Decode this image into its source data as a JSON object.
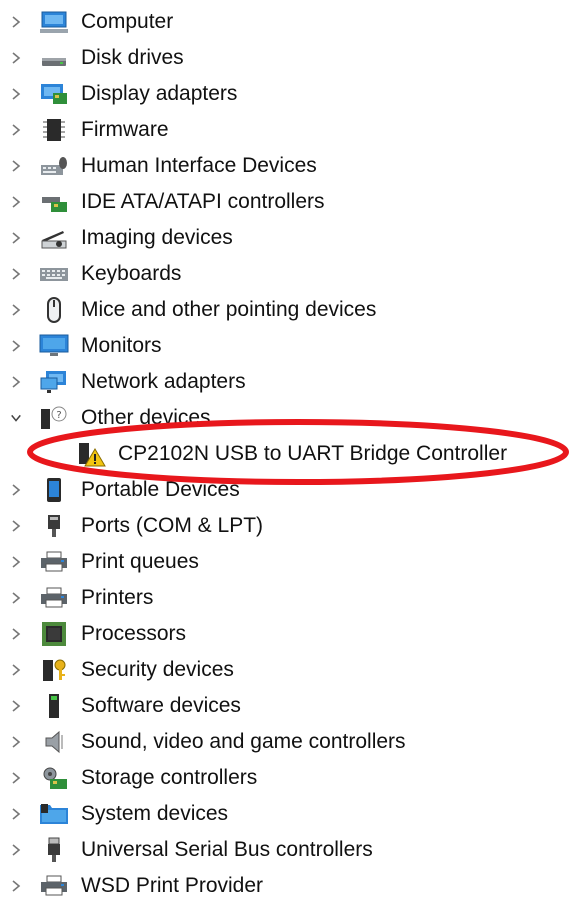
{
  "tree": {
    "items": [
      {
        "label": "Computer",
        "icon": "computer-icon"
      },
      {
        "label": "Disk drives",
        "icon": "disk-drive-icon"
      },
      {
        "label": "Display adapters",
        "icon": "display-adapter-icon"
      },
      {
        "label": "Firmware",
        "icon": "firmware-icon"
      },
      {
        "label": "Human Interface Devices",
        "icon": "hid-icon"
      },
      {
        "label": "IDE ATA/ATAPI controllers",
        "icon": "ide-controller-icon"
      },
      {
        "label": "Imaging devices",
        "icon": "imaging-device-icon"
      },
      {
        "label": "Keyboards",
        "icon": "keyboard-icon"
      },
      {
        "label": "Mice and other pointing devices",
        "icon": "mouse-icon"
      },
      {
        "label": "Monitors",
        "icon": "monitor-icon"
      },
      {
        "label": "Network adapters",
        "icon": "network-adapter-icon"
      },
      {
        "label": "Other devices",
        "icon": "unknown-device-icon",
        "expanded": true,
        "children": [
          {
            "label": "CP2102N USB to UART Bridge Controller",
            "icon": "warning-device-icon"
          }
        ]
      },
      {
        "label": "Portable Devices",
        "icon": "portable-device-icon"
      },
      {
        "label": "Ports (COM & LPT)",
        "icon": "port-icon"
      },
      {
        "label": "Print queues",
        "icon": "printer-icon"
      },
      {
        "label": "Printers",
        "icon": "printer-icon"
      },
      {
        "label": "Processors",
        "icon": "processor-icon"
      },
      {
        "label": "Security devices",
        "icon": "security-device-icon"
      },
      {
        "label": "Software devices",
        "icon": "software-device-icon"
      },
      {
        "label": "Sound, video and game controllers",
        "icon": "sound-icon"
      },
      {
        "label": "Storage controllers",
        "icon": "storage-controller-icon"
      },
      {
        "label": "System devices",
        "icon": "system-device-icon"
      },
      {
        "label": "Universal Serial Bus controllers",
        "icon": "usb-icon"
      },
      {
        "label": "WSD Print Provider",
        "icon": "printer-icon"
      }
    ]
  },
  "annotation": {
    "color": "#e8171c",
    "shape": "oval-highlight"
  }
}
